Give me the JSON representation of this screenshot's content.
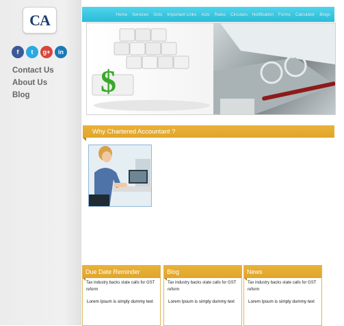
{
  "logo": {
    "text": "CA"
  },
  "social": [
    {
      "label": "f",
      "icon": "facebook-icon",
      "color": "#3b5998"
    },
    {
      "label": "t",
      "icon": "twitter-icon",
      "color": "#2aa9e0"
    },
    {
      "label": "g+",
      "icon": "google-plus-icon",
      "color": "#d8453a"
    },
    {
      "label": "in",
      "icon": "linkedin-icon",
      "color": "#1c78b5"
    }
  ],
  "sidebar": {
    "links": [
      "Contact Us",
      "About Us",
      "Blog"
    ]
  },
  "nav": {
    "items": [
      "Home",
      "Services",
      "Gsts",
      "Important Links",
      "Acts",
      "Rates",
      "Circulars",
      "Notification",
      "Forms",
      "Calculator",
      "Blogs"
    ]
  },
  "section": {
    "title": "Why Chartered Accountant ?"
  },
  "boxes": [
    {
      "title": "Due Date Reminder",
      "news": "Tax industry backs state calls for GST reform",
      "lorem": "Lorem Ipsum is simply dummy text"
    },
    {
      "title": "Blog",
      "news": "Tax industry backs state calls for GST reform",
      "lorem": "Lorem Ipsum is simply dummy text"
    },
    {
      "title": "News",
      "news": "Tax industry backs state calls for GST reform",
      "lorem": "Lorem Ipsum is simply dummy text"
    }
  ],
  "colors": {
    "accent": "#e0a52a",
    "nav": "#29bcd8"
  }
}
